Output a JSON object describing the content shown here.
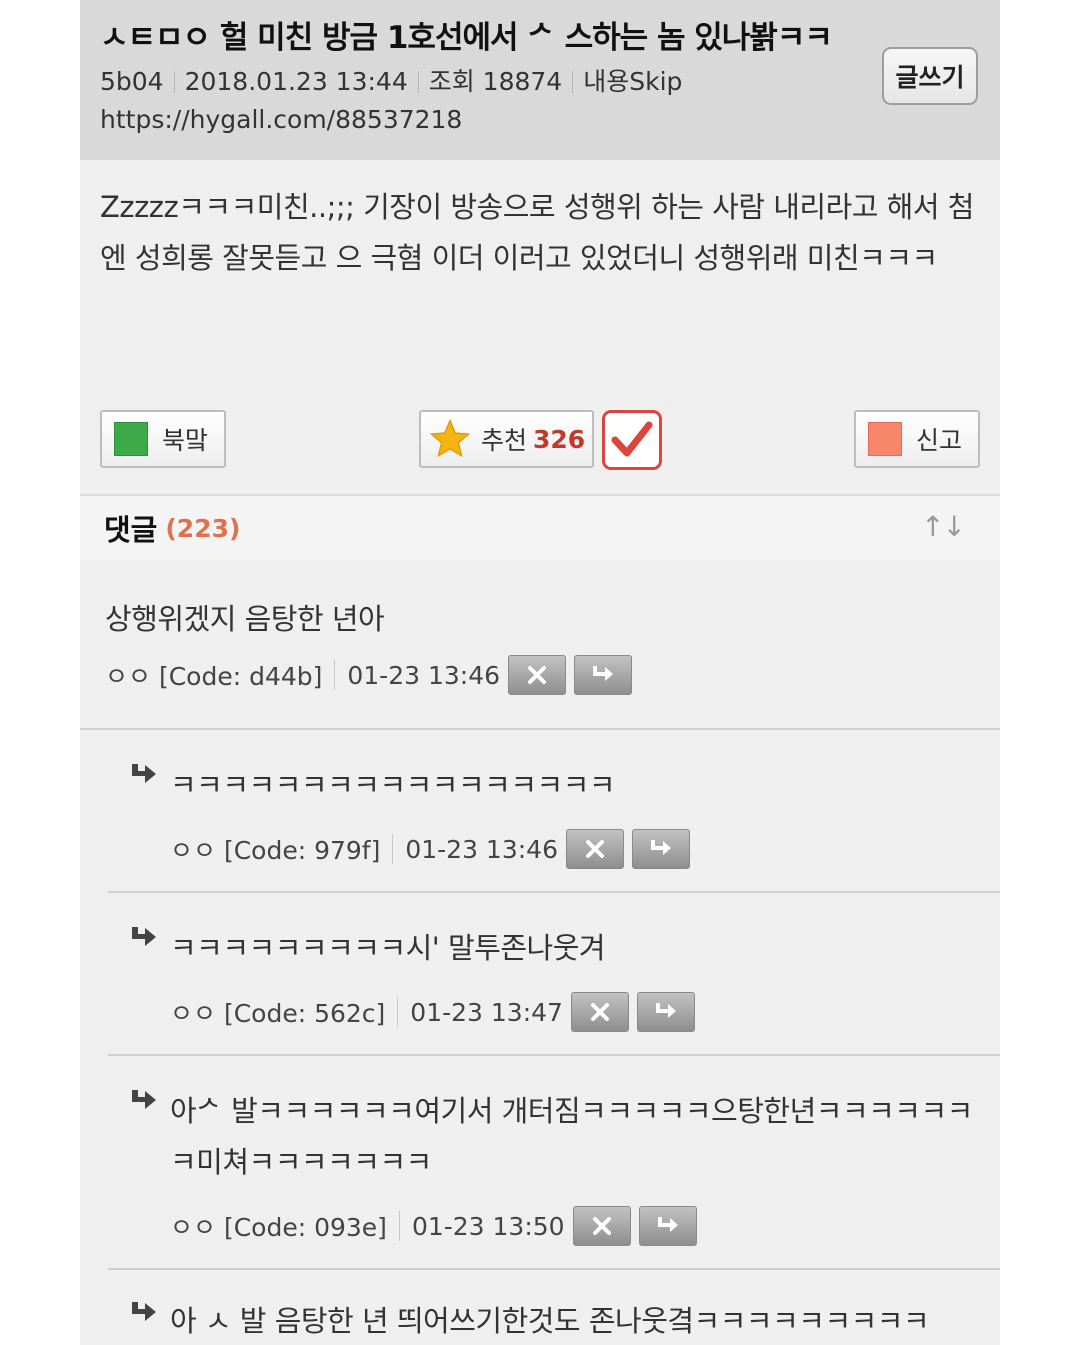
{
  "post": {
    "title": "ㅅㅌㅁㅇ 헐 미친 방금 1호선에서 ᄼ 스하는 놈 있나봙ㅋㅋ",
    "author": "5b04",
    "date": "2018.01.23 13:44",
    "views_label": "조회 18874",
    "skip_label": "내용Skip",
    "url": "https://hygall.com/88537218",
    "write_button": "글쓰기",
    "body": "Zzzzzㅋㅋㅋ미친..;;; 기장이 방송으로 성행위 하는 사람 내리라고 해서 첨엔 성희롱 잘못듣고 으 극혐 이더 이러고 있었더니 성행위래 미친ㅋㅋㅋ"
  },
  "actions": {
    "bookmark_label": "북맠",
    "recommend_label": "추천",
    "recommend_count": "326",
    "report_label": "신고"
  },
  "comments_header": {
    "title": "댓글",
    "count": "(223)",
    "sort_icon": "↑↓"
  },
  "comments": [
    {
      "text": "상행위겠지 음탕한 년아",
      "author": "ㅇㅇ [Code: d44b]",
      "time": "01-23 13:46"
    },
    {
      "text": "ㅋㅋㅋㅋㅋㅋㅋㅋㅋㅋㅋㅋㅋㅋㅋㅋㅋ",
      "author": "ㅇㅇ [Code: 979f]",
      "time": "01-23 13:46"
    },
    {
      "text": "ㅋㅋㅋㅋㅋㅋㅋㅋㅋ시' 말투존나웃겨",
      "author": "ㅇㅇ [Code: 562c]",
      "time": "01-23 13:47"
    },
    {
      "text": "아ᄼ 발ㅋㅋㅋㅋㅋㅋ여기서 개터짐ㅋㅋㅋㅋㅋ으탕한년ㅋㅋㅋㅋㅋㅋㅋ미쳐ㅋㅋㅋㅋㅋㅋㅋ",
      "author": "ㅇㅇ [Code: 093e]",
      "time": "01-23 13:50"
    },
    {
      "text": "아 ㅅ 발 음탕한 년 띄어쓰기한것도 존나웃곀ㅋㅋㅋㅋㅋㅋㅋㅋㅋ"
    }
  ]
}
